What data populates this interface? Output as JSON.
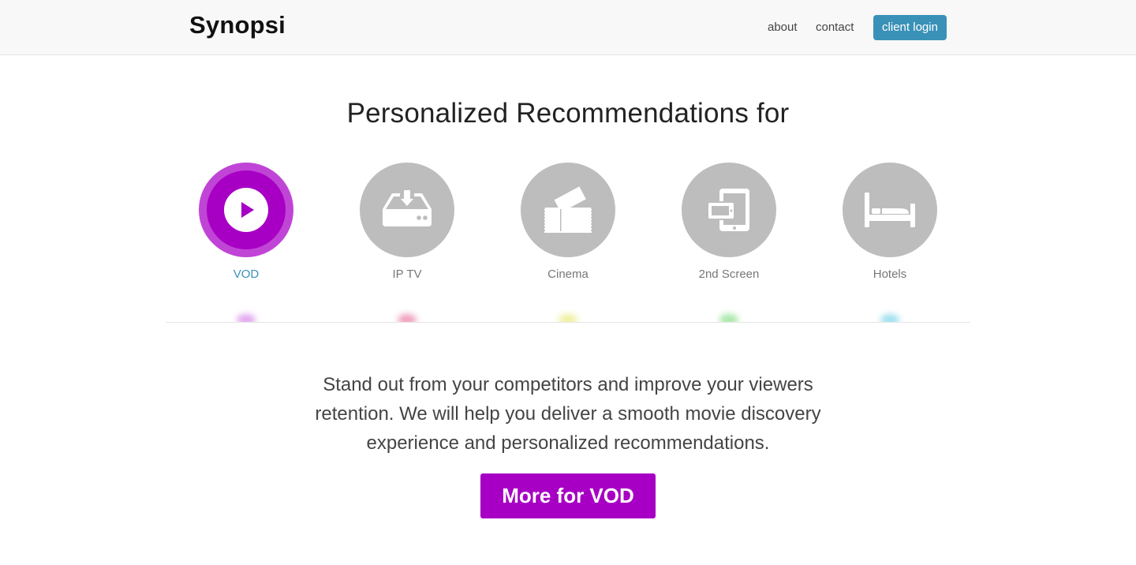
{
  "header": {
    "brand": "Synopsi",
    "nav": {
      "about": "about",
      "contact": "contact",
      "login": "client login"
    }
  },
  "hero": {
    "headline": "Personalized Recommendations for"
  },
  "segments": [
    {
      "label": "VOD",
      "icon": "play-icon",
      "active": true
    },
    {
      "label": "IP TV",
      "icon": "set-top-box-icon",
      "active": false
    },
    {
      "label": "Cinema",
      "icon": "cinema-tickets-icon",
      "active": false
    },
    {
      "label": "2nd Screen",
      "icon": "devices-icon",
      "active": false
    },
    {
      "label": "Hotels",
      "icon": "bed-icon",
      "active": false
    }
  ],
  "glow_colors": [
    "#c44fe0",
    "#e0407a",
    "#e0e040",
    "#50d050",
    "#40c0e0"
  ],
  "content": {
    "description": "Stand out from your competitors and improve your viewers retention. We will help you deliver a smooth movie discovery experience and personalized recommendations.",
    "cta_label": "More for VOD"
  },
  "colors": {
    "accent_purple": "#a700c4",
    "login_blue": "#3a91b7",
    "inactive_gray": "#bdbdbd"
  }
}
